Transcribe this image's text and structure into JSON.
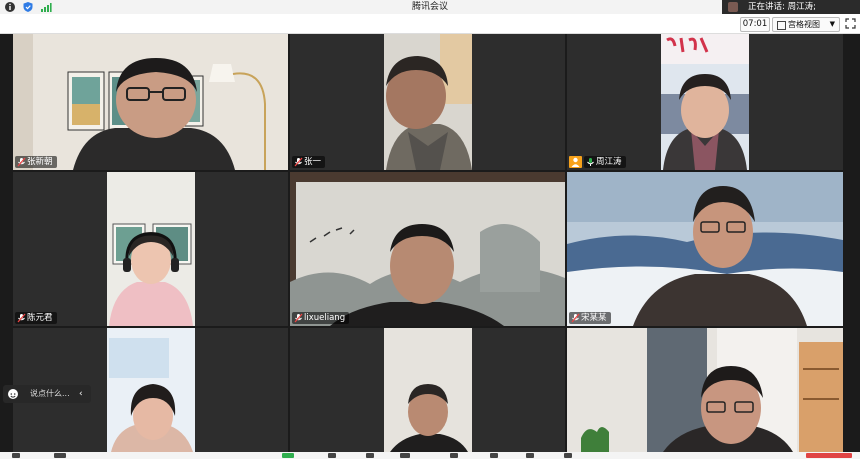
{
  "window": {
    "title": "腾讯会议"
  },
  "status": {
    "speaking_label": "正在讲话: 周江涛;",
    "timer": "07:01",
    "view_mode": "宫格视图"
  },
  "participants": [
    {
      "name": "张新朝"
    },
    {
      "name": "张一"
    },
    {
      "name": "周江涛"
    },
    {
      "name": "陈元君"
    },
    {
      "name": "lixueliang"
    },
    {
      "name": "宋某某"
    },
    {
      "name": ""
    },
    {
      "name": ""
    },
    {
      "name": ""
    }
  ],
  "chat": {
    "placeholder": "说点什么..."
  },
  "colors": {
    "host_badge": "#f7a21b",
    "signal_green": "#2fae4e",
    "shield_blue": "#2f7be5"
  }
}
